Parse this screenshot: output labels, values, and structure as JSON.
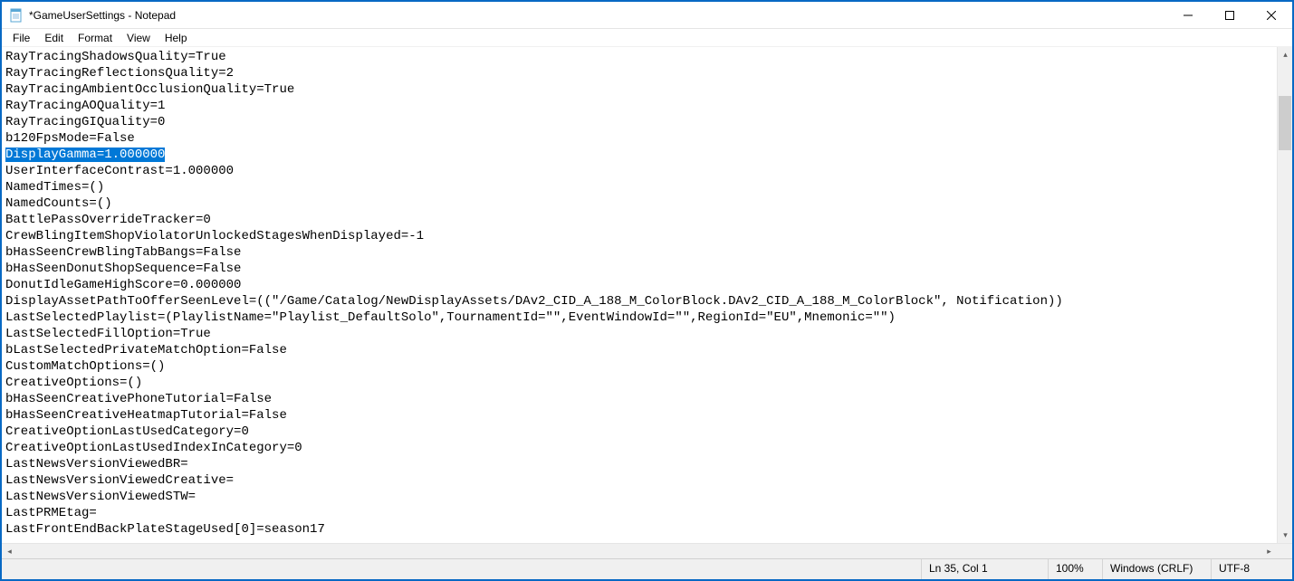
{
  "window": {
    "title": "*GameUserSettings - Notepad"
  },
  "menu": {
    "file": "File",
    "edit": "Edit",
    "format": "Format",
    "view": "View",
    "help": "Help"
  },
  "editor": {
    "selected_line_index": 6,
    "lines": [
      "RayTracingShadowsQuality=True",
      "RayTracingReflectionsQuality=2",
      "RayTracingAmbientOcclusionQuality=True",
      "RayTracingAOQuality=1",
      "RayTracingGIQuality=0",
      "b120FpsMode=False",
      "DisplayGamma=1.000000",
      "UserInterfaceContrast=1.000000",
      "NamedTimes=()",
      "NamedCounts=()",
      "BattlePassOverrideTracker=0",
      "CrewBlingItemShopViolatorUnlockedStagesWhenDisplayed=-1",
      "bHasSeenCrewBlingTabBangs=False",
      "bHasSeenDonutShopSequence=False",
      "DonutIdleGameHighScore=0.000000",
      "DisplayAssetPathToOfferSeenLevel=((\"/Game/Catalog/NewDisplayAssets/DAv2_CID_A_188_M_ColorBlock.DAv2_CID_A_188_M_ColorBlock\", Notification))",
      "LastSelectedPlaylist=(PlaylistName=\"Playlist_DefaultSolo\",TournamentId=\"\",EventWindowId=\"\",RegionId=\"EU\",Mnemonic=\"\")",
      "LastSelectedFillOption=True",
      "bLastSelectedPrivateMatchOption=False",
      "CustomMatchOptions=()",
      "CreativeOptions=()",
      "bHasSeenCreativePhoneTutorial=False",
      "bHasSeenCreativeHeatmapTutorial=False",
      "CreativeOptionLastUsedCategory=0",
      "CreativeOptionLastUsedIndexInCategory=0",
      "LastNewsVersionViewedBR=",
      "LastNewsVersionViewedCreative=",
      "LastNewsVersionViewedSTW=",
      "LastPRMEtag=",
      "LastFrontEndBackPlateStageUsed[0]=season17"
    ]
  },
  "status": {
    "position": "Ln 35, Col 1",
    "zoom": "100%",
    "line_ending": "Windows (CRLF)",
    "encoding": "UTF-8"
  }
}
